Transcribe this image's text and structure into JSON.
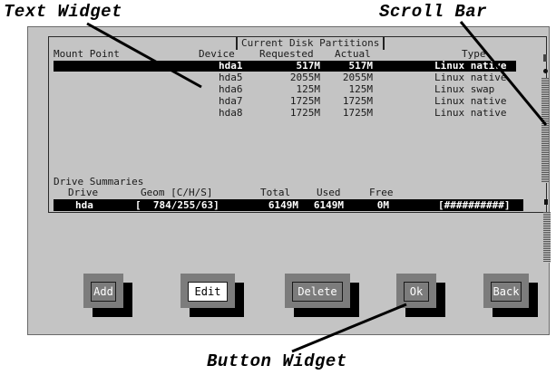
{
  "callouts": {
    "text_widget": "Text Widget",
    "scroll_bar": "Scroll Bar",
    "button_widget": "Button Widget"
  },
  "dialog": {
    "title": "Current Disk Partitions",
    "columns": [
      "Mount Point",
      "Device",
      "Requested",
      "Actual",
      "Type"
    ],
    "rows": [
      {
        "mount": "",
        "device": "hda1",
        "requested": "517M",
        "actual": "517M",
        "type": "Linux native",
        "selected": true
      },
      {
        "mount": "",
        "device": "hda5",
        "requested": "2055M",
        "actual": "2055M",
        "type": "Linux native",
        "selected": false
      },
      {
        "mount": "",
        "device": "hda6",
        "requested": "125M",
        "actual": "125M",
        "type": "Linux swap",
        "selected": false
      },
      {
        "mount": "",
        "device": "hda7",
        "requested": "1725M",
        "actual": "1725M",
        "type": "Linux native",
        "selected": false
      },
      {
        "mount": "",
        "device": "hda8",
        "requested": "1725M",
        "actual": "1725M",
        "type": "Linux native",
        "selected": false
      }
    ],
    "summaries": {
      "heading": "Drive Summaries",
      "columns": [
        "Drive",
        "Geom [C/H/S]",
        "Total",
        "Used",
        "Free"
      ],
      "row": {
        "drive": "hda",
        "geom": "[  784/255/63]",
        "total": "6149M",
        "used": "6149M",
        "free": "0M",
        "bar": "[##########]"
      }
    },
    "buttons": [
      {
        "label": "Add",
        "focused": false
      },
      {
        "label": "Edit",
        "focused": true
      },
      {
        "label": "Delete",
        "focused": false
      },
      {
        "label": "Ok",
        "focused": false
      },
      {
        "label": "Back",
        "focused": false
      }
    ]
  }
}
